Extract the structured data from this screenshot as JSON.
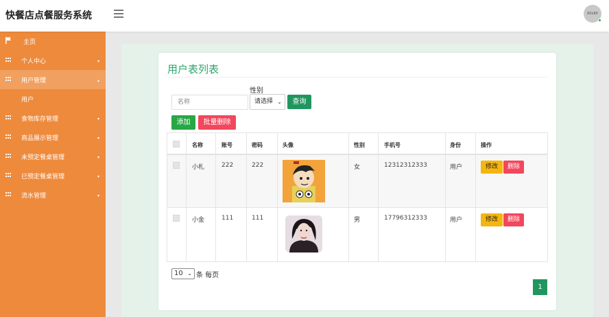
{
  "app": {
    "title": "快餐店点餐服务系统",
    "avatar_text": "80x80"
  },
  "sidebar": {
    "items": [
      {
        "label": "主页"
      },
      {
        "label": "个人中心"
      },
      {
        "label": "用户管理"
      },
      {
        "label": "用户"
      },
      {
        "label": "食物库存管理"
      },
      {
        "label": "商品展示管理"
      },
      {
        "label": "未预定餐桌管理"
      },
      {
        "label": "已预定餐桌管理"
      },
      {
        "label": "流水管理"
      }
    ]
  },
  "main": {
    "title": "用户表列表",
    "search_placeholder": "名称",
    "gender_label": "性别",
    "gender_select": "请选择",
    "query_button": "查询",
    "add_button": "添加",
    "bulk_delete_button": "批量删除"
  },
  "table": {
    "columns": [
      "名称",
      "账号",
      "密码",
      "头像",
      "性别",
      "手机号",
      "身份",
      "操作"
    ],
    "rows": [
      {
        "name": "小札",
        "account": "222",
        "password": "222",
        "gender": "女",
        "phone": "12312312333",
        "role": "用户",
        "edit": "修改",
        "delete": "删除"
      },
      {
        "name": "小金",
        "account": "111",
        "password": "111",
        "gender": "男",
        "phone": "17796312333",
        "role": "用户",
        "edit": "修改",
        "delete": "删除"
      }
    ]
  },
  "pager": {
    "page_size": "10",
    "page_size_label": "条 每页",
    "current_page": "1"
  },
  "colors": {
    "sidebar": "#ee8a3c",
    "accent_green": "#20965f",
    "danger": "#f2475c",
    "warning": "#f5b50f"
  }
}
